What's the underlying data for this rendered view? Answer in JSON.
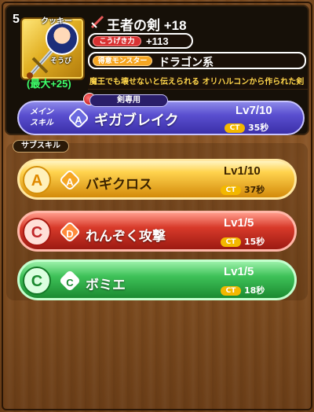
{
  "weapon": {
    "level": "5",
    "name": "王者の剣 +18",
    "owner_label": "クッキー",
    "equip_label": "そうび",
    "max_label": "(最大+25)",
    "stat_name": "こうげき力",
    "stat_value": "+113",
    "monster_tag": "得意モンスター",
    "monster_value": "ドラゴン系",
    "description": "魔王でも壊せないと伝えられる オリハルコンから作られた剣"
  },
  "main_skill": {
    "label_line1": "メイン",
    "label_line2": "スキル",
    "tag": "剣専用",
    "rank": "A",
    "name": "ギガブレイク",
    "level": "Lv7/10",
    "ct_label": "CT",
    "ct_value": "35秒"
  },
  "sub_section_label": "サブスキル",
  "sub_skills": [
    {
      "rank_big": "A",
      "rank": "A",
      "name": "バギクロス",
      "level": "Lv1/10",
      "ct_label": "CT",
      "ct_value": "37秒"
    },
    {
      "rank_big": "C",
      "rank": "D",
      "name": "れんぞく攻撃",
      "level": "Lv1/5",
      "ct_label": "CT",
      "ct_value": "15秒"
    },
    {
      "rank_big": "C",
      "rank": "C",
      "name": "ボミエ",
      "level": "Lv1/5",
      "ct_label": "CT",
      "ct_value": "18秒"
    }
  ],
  "colors": {
    "gold": "#e2b024",
    "main_skill": "#5a4fd0",
    "sub1": "#ffd34e",
    "sub2": "#d83a2a",
    "sub3": "#3ec158",
    "ct_pill": "#f3b800",
    "max_text": "#3dff6a",
    "desc_text": "#ffd64a"
  }
}
